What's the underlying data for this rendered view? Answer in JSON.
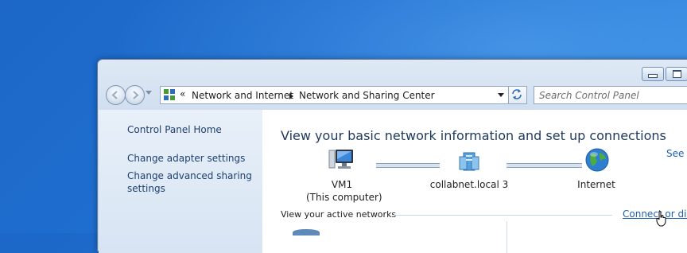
{
  "window": {
    "controls": {
      "minimize_icon": "minimize-icon",
      "maximize_icon": "maximize-icon"
    }
  },
  "nav": {
    "back_icon": "back-arrow-icon",
    "forward_icon": "forward-arrow-icon",
    "history_dropdown_icon": "chevron-down-icon"
  },
  "address": {
    "overflow": "«",
    "breadcrumbs": [
      "Network and Internet",
      "Network and Sharing Center"
    ],
    "refresh_icon": "refresh-icon"
  },
  "search": {
    "placeholder": "Search Control Panel"
  },
  "left_pane": {
    "items": [
      {
        "label": "Control Panel Home"
      },
      {
        "label": "Change adapter settings"
      },
      {
        "label": "Change advanced sharing\nsettings"
      }
    ]
  },
  "content": {
    "title": "View your basic network information and set up connections",
    "see_full_map": "See f",
    "nodes": [
      {
        "label": "VM1",
        "sublabel": "(This computer)",
        "icon": "computer-icon"
      },
      {
        "label": "collabnet.local  3",
        "icon": "network-server-icon"
      },
      {
        "label": "Internet",
        "icon": "globe-icon"
      }
    ],
    "active_networks_label": "View your active networks",
    "connect_link": "Connect or disc"
  },
  "colors": {
    "desktop": "#1f6fd0",
    "link": "#1f5eab",
    "title": "#1e395b",
    "left_pane": "#dfe9f5"
  }
}
